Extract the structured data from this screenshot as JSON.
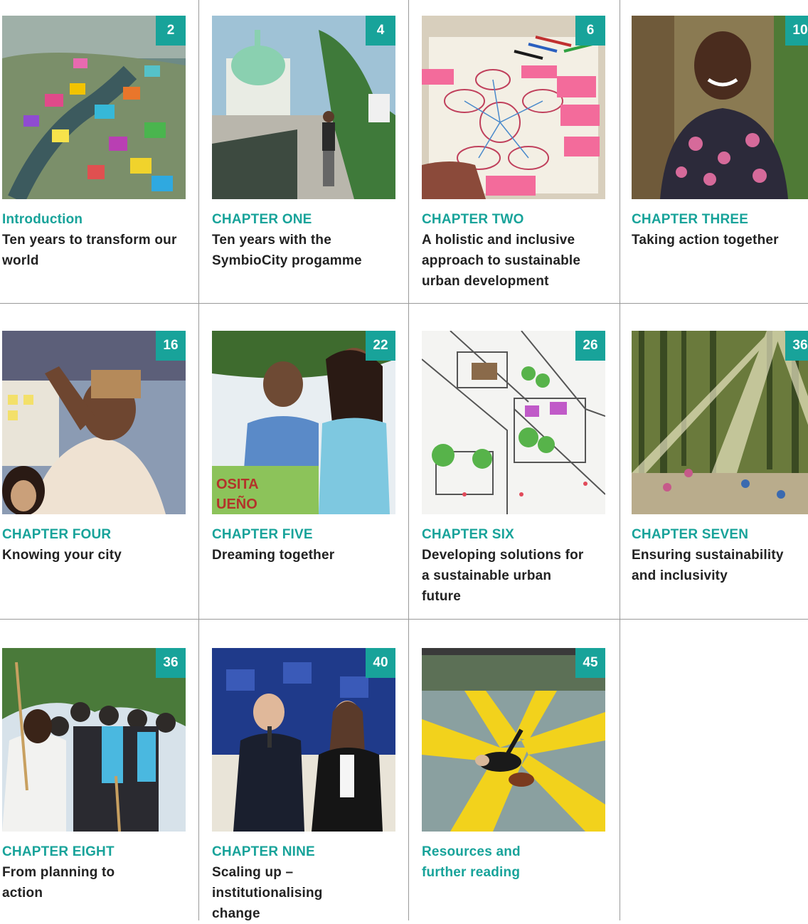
{
  "toc": [
    {
      "page": "2",
      "chapter": "Introduction",
      "title": "Ten years to transform our world"
    },
    {
      "page": "4",
      "chapter": "CHAPTER ONE",
      "title": "Ten years with the SymbioCity progamme"
    },
    {
      "page": "6",
      "chapter": "CHAPTER TWO",
      "title": "A holistic and inclusive approach to sustainable urban development"
    },
    {
      "page": "10",
      "chapter": "CHAPTER THREE",
      "title": "Taking action together"
    },
    {
      "page": "16",
      "chapter": "CHAPTER FOUR",
      "title": "Knowing your city"
    },
    {
      "page": "22",
      "chapter": "CHAPTER FIVE",
      "title": "Dreaming together"
    },
    {
      "page": "26",
      "chapter": "CHAPTER SIX",
      "title": "Developing solutions for a sustainable urban future"
    },
    {
      "page": "36",
      "chapter": "CHAPTER SEVEN",
      "title": "Ensuring sustainability and inclusivity"
    },
    {
      "page": "36",
      "chapter": "CHAPTER EIGHT",
      "title": "From planning to action"
    },
    {
      "page": "40",
      "chapter": "CHAPTER NINE",
      "title": "Scaling up – institutionalising change"
    },
    {
      "page": "45",
      "chapter": "Resources and further reading",
      "title": ""
    }
  ],
  "photo_text": {
    "box_sign": "OSITA\nUEÑO"
  },
  "colors": {
    "accent": "#18a39a",
    "text": "#222222",
    "rule": "#9a9a9a"
  }
}
